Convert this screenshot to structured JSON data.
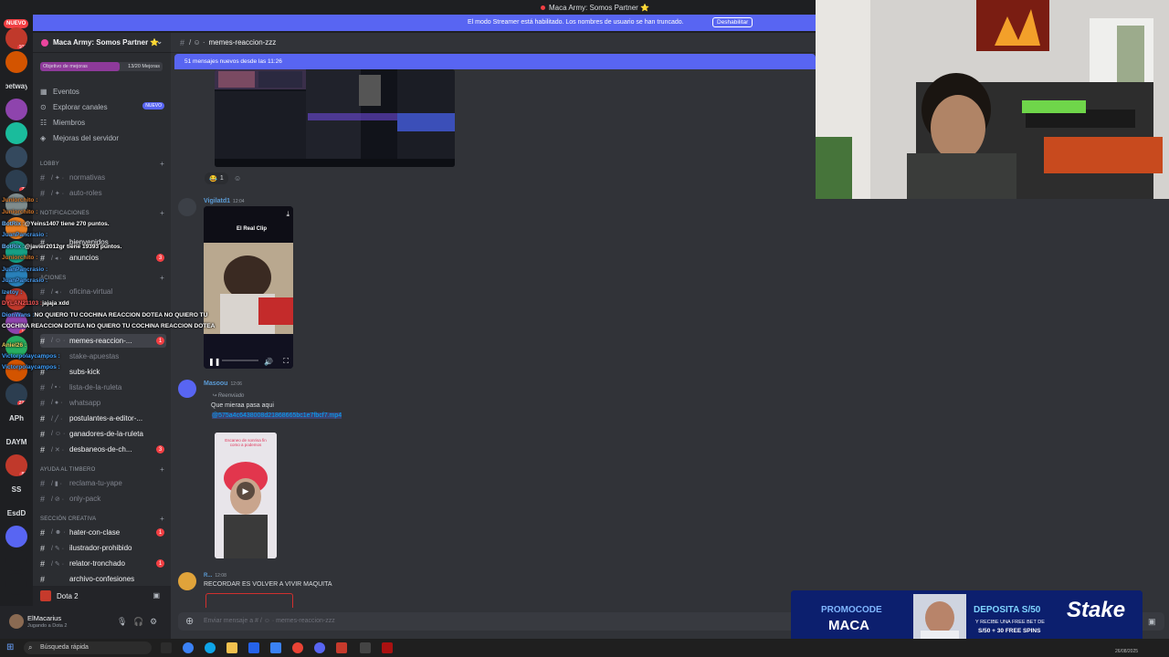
{
  "window": {
    "title": "Maca Army: Somos Partner ⭐"
  },
  "streamer_mode": {
    "message": "El modo Streamer está habilitado. Los nombres de usuario se han truncado.",
    "button": "Deshabilitar"
  },
  "rail": {
    "new_badge": "NUEVO",
    "servers": [
      {
        "label": "",
        "count": "106"
      },
      {
        "label": "",
        "count": ""
      },
      {
        "label": "betway",
        "count": ""
      },
      {
        "label": "",
        "count": ""
      },
      {
        "label": "",
        "count": ""
      },
      {
        "label": "",
        "count": ""
      },
      {
        "label": "",
        "count": "71"
      },
      {
        "label": "",
        "count": ""
      },
      {
        "label": "",
        "count": ""
      },
      {
        "label": "",
        "count": ""
      },
      {
        "label": "",
        "count": ""
      },
      {
        "label": "",
        "count": ""
      },
      {
        "label": "",
        "count": "16"
      },
      {
        "label": "",
        "count": ""
      },
      {
        "label": "",
        "count": ""
      },
      {
        "label": "",
        "count": "224"
      },
      {
        "label": "APh",
        "count": ""
      },
      {
        "label": "DAYM",
        "count": ""
      },
      {
        "label": "",
        "count": "87"
      },
      {
        "label": "SS",
        "count": ""
      },
      {
        "label": "EsdD",
        "count": ""
      },
      {
        "label": "",
        "count": ""
      },
      {
        "label": "",
        "count": ""
      },
      {
        "label": "",
        "count": ""
      }
    ]
  },
  "server": {
    "name": "Maca Army: Somos Partner ⭐",
    "boost_label": "Objetivo de mejoras",
    "boost_count": "13/20 Mejoras",
    "boost_progress": 0.65,
    "nav": [
      {
        "label": "Eventos",
        "icon": "calendar-icon",
        "tag": ""
      },
      {
        "label": "Explorar canales",
        "icon": "compass-icon",
        "tag": "NUEVO"
      },
      {
        "label": "Miembros",
        "icon": "members-icon",
        "tag": ""
      },
      {
        "label": "Mejoras del servidor",
        "icon": "boost-icon",
        "tag": ""
      }
    ],
    "categories": [
      {
        "label": "LOBBY"
      },
      {
        "label": "NOTIFICACIONES"
      },
      {
        "label": "ACIONES"
      },
      {
        "label": "AYUDA AL TIMBERO"
      },
      {
        "label": "SECCIÓN CREATIVA"
      }
    ],
    "channels": [
      {
        "label": "normativas",
        "emoji": "/ ✦ ·",
        "badge": "",
        "unread": false
      },
      {
        "label": "auto-roles",
        "emoji": "/ ✦ ·",
        "badge": "",
        "unread": false
      },
      {
        "label": "bienvenidos",
        "emoji": "",
        "badge": "",
        "unread": true
      },
      {
        "label": "anuncios",
        "emoji": "/ ◂ ·",
        "badge": "3",
        "unread": true
      },
      {
        "label": "oficina-virtual",
        "emoji": "/ ◂ ·",
        "badge": "",
        "unread": false
      },
      {
        "label": "memes-reaccion-...",
        "emoji": "/ ☺ ·",
        "badge": "1",
        "unread": true
      },
      {
        "label": "stake-apuestas",
        "emoji": "",
        "badge": "",
        "unread": false
      },
      {
        "label": "subs-kick",
        "emoji": "",
        "badge": "",
        "unread": true
      },
      {
        "label": "lista-de-la-ruleta",
        "emoji": "/ ▪ ·",
        "badge": "",
        "unread": false
      },
      {
        "label": "whatsapp",
        "emoji": "/ ● ·",
        "badge": "",
        "unread": false
      },
      {
        "label": "postulantes-a-editor-...",
        "emoji": "/ ╱ ·",
        "badge": "",
        "unread": true
      },
      {
        "label": "ganadores-de-la-ruleta",
        "emoji": "/ ☺ ·",
        "badge": "",
        "unread": true
      },
      {
        "label": "desbaneos-de-ch...",
        "emoji": "/ ✕ ·",
        "badge": "3",
        "unread": true
      },
      {
        "label": "reclama-tu-yape",
        "emoji": "/ ▮ ·",
        "badge": "",
        "unread": false
      },
      {
        "label": "only-pack",
        "emoji": "/ ⊘ ·",
        "badge": "",
        "unread": false
      },
      {
        "label": "hater-con-clase",
        "emoji": "/ ☻ ·",
        "badge": "1",
        "unread": true
      },
      {
        "label": "ilustrador-prohibido",
        "emoji": "/ ✎ ·",
        "badge": "",
        "unread": true
      },
      {
        "label": "relator-tronchado",
        "emoji": "/ ✎ ·",
        "badge": "1",
        "unread": true
      },
      {
        "label": "archivo-confesiones",
        "emoji": "",
        "badge": "",
        "unread": true
      }
    ]
  },
  "voice": {
    "label": "Dota 2"
  },
  "user": {
    "name": "ElMacarius",
    "status": "Jugando a Dota 2"
  },
  "chat": {
    "channel": "memes-reaccion-zzz",
    "channel_prefix": "/ ☺ ·",
    "new_messages": "51 mensajes nuevos desde las 11:26",
    "reaction_count": "1",
    "messages": [
      {
        "author": "Vigilatd1",
        "time": "12:04",
        "color": "#5b9bd5"
      },
      {
        "author": "Masoou",
        "time": "12:06",
        "color": "#5b9bd5",
        "forwarded": "Reenviado",
        "text": "Que mieraa pasa aqui",
        "link": "@575a4c6438008d21868665bc1e7fbcf7.mp4"
      },
      {
        "author": "R...",
        "time": "12:08",
        "color": "#5b9bd5",
        "text": "RECORDAR ES VOLVER A VIVIR MAQUITA"
      }
    ],
    "video1_caption": "El Real Clip",
    "video2_caption": "Escaneo de sonrisa fin como a podemos",
    "composer_placeholder": "Enviar mensaje a # / ☺ · memes-reaccion-zzz"
  },
  "overlay_chat": [
    {
      "user": "Juniorchito :",
      "text": ""
    },
    {
      "user": "Juniorchito :",
      "text": ""
    },
    {
      "user": "BotRix :",
      "text": "@Yeins1407 tiene 270 puntos."
    },
    {
      "user": "JuanPancrasio :",
      "text": ""
    },
    {
      "user": "BotRix :",
      "text": "@javier2012gr tiene 19393 puntos."
    },
    {
      "user": "Juniorchito :",
      "text": ""
    },
    {
      "user": "JuanPancrasio :",
      "text": ""
    },
    {
      "user": "JuanPancrasio :",
      "text": ""
    },
    {
      "user": "Izetoy :",
      "text": ""
    },
    {
      "user": "DYLAN21103 :",
      "text": "jajaja xdd"
    },
    {
      "user": "DionWans :",
      "text": "NO QUIERO TU COCHINA REACCION DOTEA NO QUIERO TU"
    },
    {
      "user": "",
      "text": "COCHINA REACCION DOTEA NO QUIERO TU COCHINA REACCION DOTEA"
    },
    {
      "user": "Aniel26 :",
      "text": ""
    },
    {
      "user": "Victorpolaycampos :",
      "text": ""
    },
    {
      "user": "Victorpolaycampos :",
      "text": ""
    }
  ],
  "ad": {
    "promo_label": "PROMOCODE",
    "promo_code": "MACA",
    "deposit": "DEPOSITA S/50",
    "offer": "Y RECIBE UNA FREE BET DE",
    "offer2": "S/50 + 30 FREE SPINS",
    "brand": "Stake"
  },
  "taskbar": {
    "search_placeholder": "Búsqueda rápida",
    "date": "26/08/2025"
  },
  "colors": {
    "accent": "#5865f2",
    "danger": "#f23f43",
    "bg": "#313338",
    "sidebar": "#2b2d31"
  }
}
